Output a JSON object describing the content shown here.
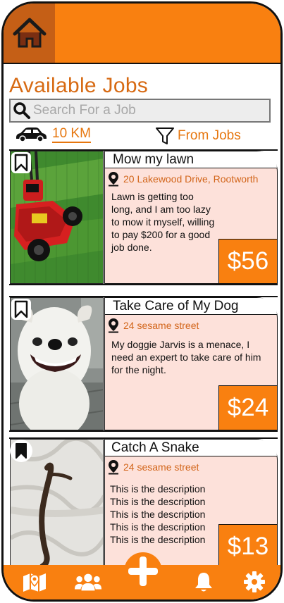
{
  "page": {
    "title": "Available Jobs"
  },
  "search": {
    "placeholder": "Search For a Job"
  },
  "filters": {
    "distance": "10 KM",
    "from_jobs": "From Jobs"
  },
  "jobs": [
    {
      "title": "Mow my lawn",
      "address": "20 Lakewood Drive, Rootworth",
      "description": "Lawn is getting too long, and I am too lazy to mow it myself, willing to pay $200 for a good job done.",
      "price": "$56",
      "bookmarked": false
    },
    {
      "title": "Take Care of My Dog",
      "address": "24 sesame street",
      "description": "My doggie Jarvis is a menace, I need an expert to take care of him for the night.",
      "price": "$24",
      "bookmarked": false
    },
    {
      "title": "Catch A Snake",
      "address": "24 sesame street",
      "description": "This is the description This is the description This is the description This is the description This is the description",
      "price": "$13",
      "bookmarked": true
    }
  ],
  "colors": {
    "accent": "#F98010",
    "accent_dark": "#C55F16",
    "card_bg": "#FDE1DA",
    "link": "#E6760E"
  },
  "icons": {
    "home": "home-icon",
    "search": "search-icon",
    "car": "car-icon",
    "filter": "filter-icon",
    "pin": "map-pin-icon",
    "bookmark": "bookmark-icon",
    "map": "map-icon",
    "people": "people-icon",
    "add": "plus-icon",
    "bell": "bell-icon",
    "settings": "gear-icon"
  }
}
